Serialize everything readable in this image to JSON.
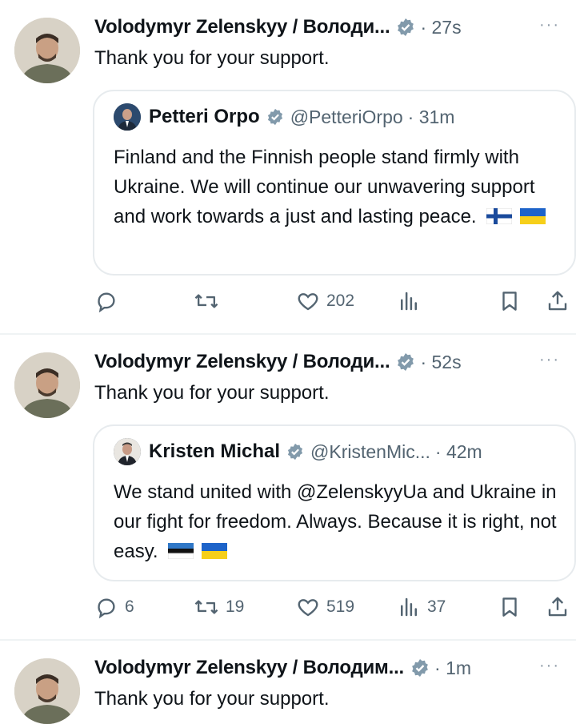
{
  "colors": {
    "accent": "#1d9bf0",
    "muted": "#536471",
    "verified": "#829aab"
  },
  "tweets": [
    {
      "author_name": "Volodymyr Zelenskyy / Володи...",
      "time": "· 27s",
      "text": "Thank you for your support.",
      "quote": {
        "name": "Petteri Orpo",
        "handle": "@PetteriOrpo",
        "time": "· 31m",
        "text": "Finland and the Finnish people stand firmly with Ukraine. We will continue our unwavering support and work towards a just and lasting peace.",
        "flags": [
          "flag-finland",
          "flag-ukraine"
        ]
      },
      "actions": {
        "replies": "",
        "reposts": "",
        "likes": "202",
        "views": ""
      }
    },
    {
      "author_name": "Volodymyr Zelenskyy / Володи...",
      "time": "· 52s",
      "text": "Thank you for your support.",
      "quote": {
        "name": "Kristen Michal",
        "handle": "@KristenMic...",
        "time": "· 42m",
        "text": "We stand united with @ZelenskyyUa and Ukraine in our fight for freedom. Always. Because it is right, not easy.",
        "flags": [
          "flag-estonia",
          "flag-ukraine"
        ]
      },
      "actions": {
        "replies": "6",
        "reposts": "19",
        "likes": "519",
        "views": "37"
      }
    },
    {
      "author_name": "Volodymyr Zelenskyy / Володим...",
      "time": "· 1m",
      "text": "Thank you for your support."
    }
  ],
  "more_label": "···"
}
